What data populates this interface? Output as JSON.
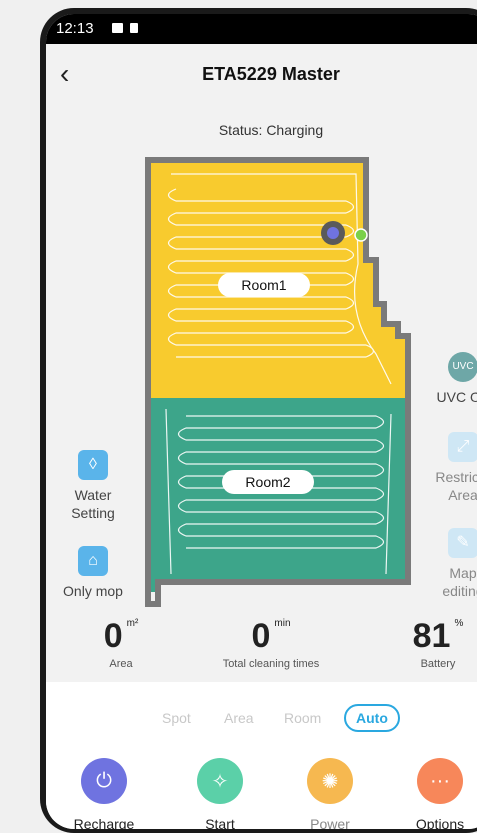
{
  "status_bar": {
    "time": "12:13"
  },
  "header": {
    "title": "ETA5229 Master"
  },
  "status": "Status: Charging",
  "map": {
    "rooms": [
      "Room1",
      "Room2"
    ]
  },
  "side_left": [
    {
      "label_line1": "Water",
      "label_line2": "Setting",
      "icon": "water-drop-icon"
    },
    {
      "label_line1": "Only mop",
      "label_line2": "",
      "icon": "mop-icon"
    }
  ],
  "side_right": [
    {
      "label_line1": "UVC OF",
      "label_line2": "",
      "icon": "uvc-icon"
    },
    {
      "label_line1": "Restricte",
      "label_line2": "Area",
      "icon": "restricted-area-icon"
    },
    {
      "label_line1": "Map",
      "label_line2": "editing",
      "icon": "map-edit-icon"
    }
  ],
  "stats": [
    {
      "value": "0",
      "unit": "m²",
      "label": "Area"
    },
    {
      "value": "0",
      "unit": "min",
      "label": "Total cleaning times"
    },
    {
      "value": "81",
      "unit": "%",
      "label": "Battery"
    }
  ],
  "modes": [
    "Spot",
    "Area",
    "Room",
    "Auto"
  ],
  "selected_mode": "Auto",
  "actions": [
    {
      "label": "Recharge",
      "color": "#6f73e0",
      "icon": "plug-icon"
    },
    {
      "label": "Start",
      "color": "#5bd0a8",
      "icon": "broom-icon"
    },
    {
      "label": "Power",
      "color": "#f6b850",
      "icon": "fan-icon"
    },
    {
      "label": "Options",
      "color": "#f7875a",
      "icon": "more-icon"
    }
  ],
  "colors": {
    "room1": "#f8cb2e",
    "room2": "#3da58a",
    "wall": "#7a7a7a",
    "accent": "#2aa8e0"
  }
}
